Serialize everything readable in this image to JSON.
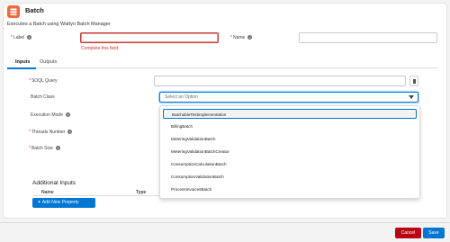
{
  "header": {
    "title": "Batch",
    "subtitle": "Executes a Batch using Wattyo Batch Manager",
    "icon": "stack-icon",
    "icon_color": "#f16a3d"
  },
  "form": {
    "label_field": {
      "label": "Label",
      "value": "",
      "error": "Complete this field."
    },
    "name_field": {
      "label": "Name",
      "value": ""
    }
  },
  "tabs": [
    {
      "label": "Inputs",
      "active": true
    },
    {
      "label": "Outputs",
      "active": false
    }
  ],
  "inputs": {
    "soql_query": {
      "label": "SOQL Query",
      "value": ""
    },
    "batch_class": {
      "label": "Batch Class",
      "placeholder": "Select an Option"
    },
    "execution_mode": {
      "label": "Execution Mode"
    },
    "threads_number": {
      "label": "Threads Number"
    },
    "batch_size": {
      "label": "Batch Size"
    }
  },
  "dropdown": {
    "options": [
      "BatchableTestImplementation",
      "BillingBatch",
      "MeteringValidationBatch",
      "MeteringValidationBatchCreator",
      "ConsumptionCalculationBatch",
      "ConsumptionValidationBatch",
      "ProcessInvoicesBatch"
    ],
    "highlighted_index": 0
  },
  "additional_inputs": {
    "title": "Additional Inputs",
    "columns": [
      "Name",
      "Type"
    ],
    "add_button": "Add New Property"
  },
  "footer": {
    "cancel": "Cancel",
    "save": "Save"
  },
  "colors": {
    "brand": "#0176d3",
    "error": "#c23934",
    "cancel": "#ba0517"
  }
}
